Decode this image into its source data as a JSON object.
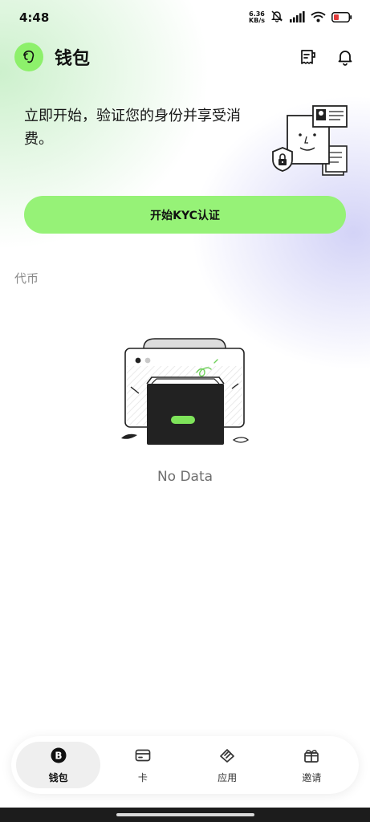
{
  "status_bar": {
    "time": "4:48",
    "net_speed_value": "6.36",
    "net_speed_unit": "KB/s",
    "icons": [
      "mute-bell-icon",
      "signal-icon",
      "wifi-icon",
      "battery-icon"
    ]
  },
  "header": {
    "title": "钱包",
    "logo_icon": "dog-logo-icon",
    "actions": [
      "receipt-icon",
      "bell-icon"
    ]
  },
  "kyc": {
    "headline": "立即开始，验证您的身份并享受消费。",
    "button_label": "开始KYC认证"
  },
  "tokens": {
    "section_label": "代币",
    "empty_text": "No Data"
  },
  "bottom_nav": {
    "items": [
      {
        "label": "钱包",
        "icon": "bitcoin-icon",
        "active": true
      },
      {
        "label": "卡",
        "icon": "card-icon",
        "active": false
      },
      {
        "label": "应用",
        "icon": "apps-icon",
        "active": false
      },
      {
        "label": "邀请",
        "icon": "gift-icon",
        "active": false
      }
    ]
  },
  "colors": {
    "accent_green": "#96f277",
    "logo_green": "#8df06b",
    "text_primary": "#111111",
    "text_muted": "#8a8a8a"
  }
}
